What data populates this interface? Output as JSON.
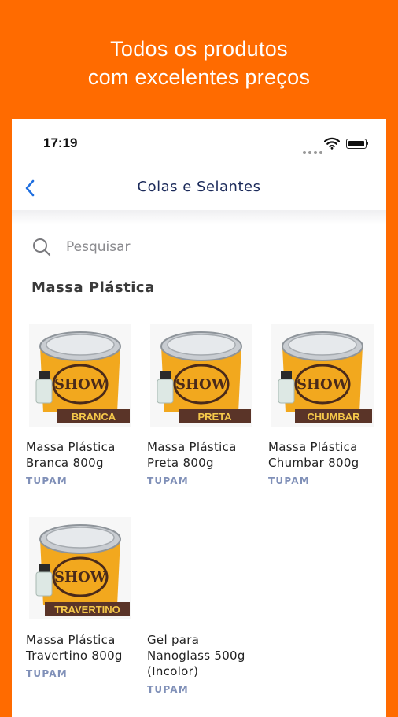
{
  "promo": {
    "line1": "Todos os produtos",
    "line2": "com excelentes preços"
  },
  "status_bar": {
    "time": "17:19"
  },
  "nav": {
    "title": "Colas e Selantes",
    "back_icon": "chevron-left-icon"
  },
  "search": {
    "placeholder": "Pesquisar",
    "value": ""
  },
  "section": {
    "title": "Massa Plástica"
  },
  "products": [
    {
      "name_line1": "Massa Plástica",
      "name_line2": "Branca 800g",
      "name_line3": "",
      "brand": "TUPAM",
      "tag": "BRANCA"
    },
    {
      "name_line1": "Massa Plástica",
      "name_line2": "Preta 800g",
      "name_line3": "",
      "brand": "TUPAM",
      "tag": "PRETA"
    },
    {
      "name_line1": "Massa Plástica",
      "name_line2": "Chumbar 800g",
      "name_line3": "",
      "brand": "TUPAM",
      "tag": "CHUMBAR"
    },
    {
      "name_line1": "Massa Plástica",
      "name_line2": "Travertino 800g",
      "name_line3": "",
      "brand": "TUPAM",
      "tag": "TRAVERTINO"
    },
    {
      "name_line1": "Gel para",
      "name_line2": "Nanoglass 500g",
      "name_line3": "(Incolor)",
      "brand": "TUPAM",
      "tag": ""
    }
  ],
  "colors": {
    "background": "#FF6B00",
    "tag_bg": "#5A3428",
    "tag_text": "#F5C84A",
    "brand": "#8090B8",
    "accent": "#1F6FE0"
  }
}
